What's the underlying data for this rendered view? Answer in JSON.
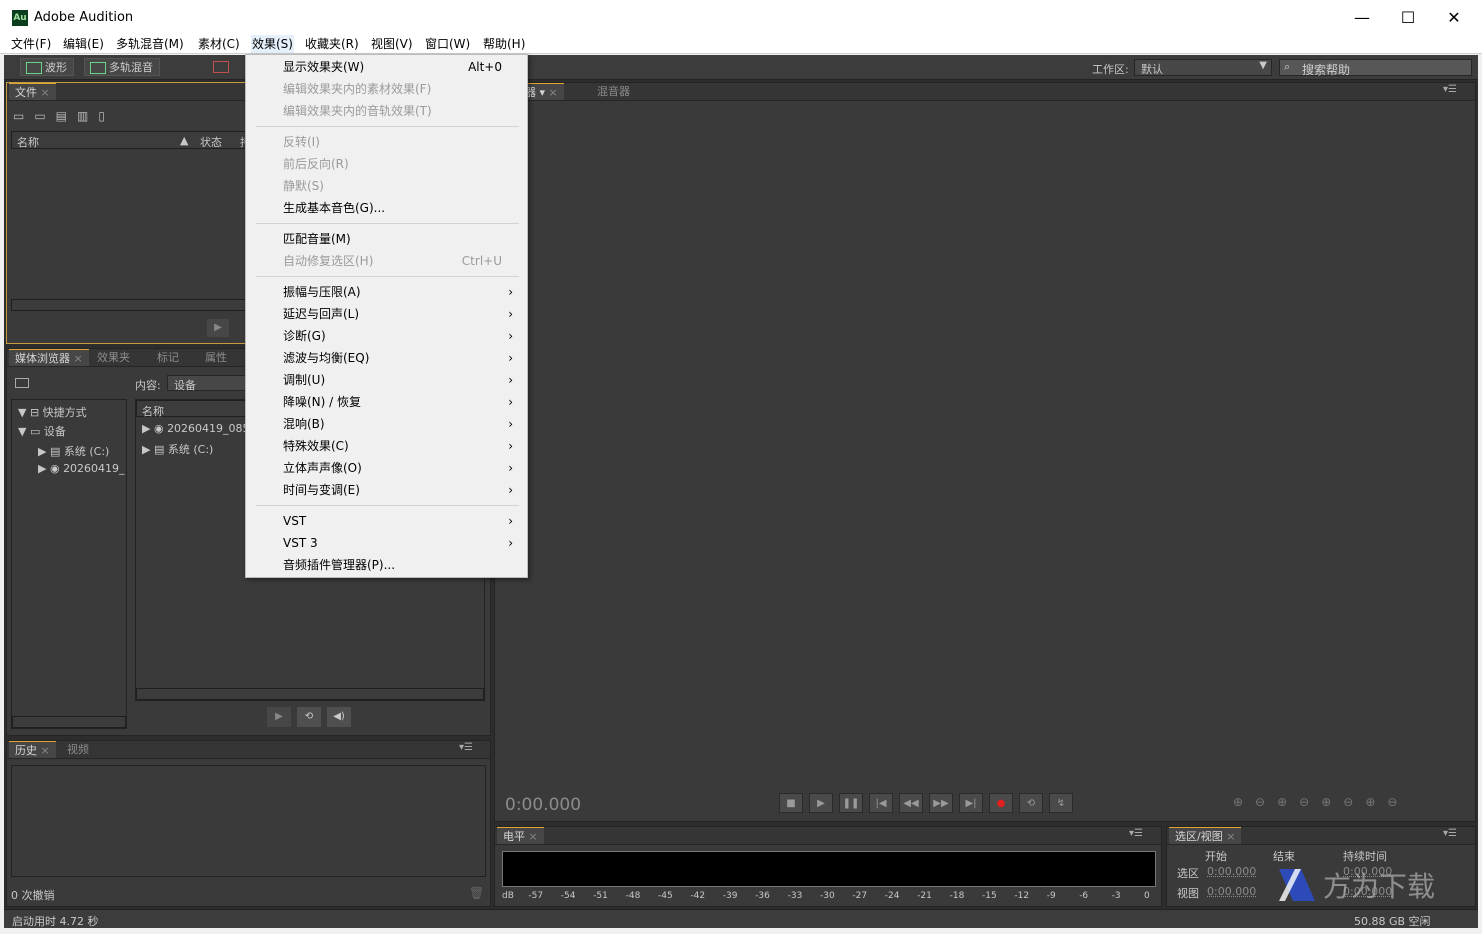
{
  "title_bar": {
    "app_icon_text": "Au",
    "title": "Adobe Audition",
    "minimize": "—",
    "maximize": "☐",
    "close": "✕"
  },
  "menubar": {
    "items": [
      "文件(F)",
      "编辑(E)",
      "多轨混音(M)",
      "素材(C)",
      "效果(S)",
      "收藏夹(R)",
      "视图(V)",
      "窗口(W)",
      "帮助(H)"
    ]
  },
  "toolbar": {
    "waveform": "波形",
    "multitrack": "多轨混音",
    "workspace_label": "工作区:",
    "workspace_value": "默认",
    "search_placeholder": "搜索帮助"
  },
  "files_panel": {
    "tab": "文件",
    "col_name": "名称",
    "col_status": "状态",
    "col_extra": "持"
  },
  "media_panel": {
    "tabs": [
      "媒体浏览器",
      "效果夹",
      "标记",
      "属性"
    ],
    "content_label": "内容:",
    "content_value": "设备",
    "tree": [
      "快捷方式",
      "设备",
      "系统 (C:)",
      "20260419_"
    ],
    "col_name": "名称",
    "list": [
      "20260419_085",
      "系统 (C:)"
    ]
  },
  "history_panel": {
    "tabs": [
      "历史",
      "视频"
    ],
    "undo_count": "0 次撤销"
  },
  "editor_panel": {
    "tabs": [
      "编辑器",
      "混音器"
    ],
    "timecode": "0:00.000"
  },
  "levels_panel": {
    "tab": "电平",
    "scale": [
      "dB",
      "-57",
      "-54",
      "-51",
      "-48",
      "-45",
      "-42",
      "-39",
      "-36",
      "-33",
      "-30",
      "-27",
      "-24",
      "-21",
      "-18",
      "-15",
      "-12",
      "-9",
      "-6",
      "-3",
      "0"
    ]
  },
  "selview_panel": {
    "tab": "选区/视图",
    "col_start": "开始",
    "col_end": "结束",
    "col_duration": "持续时间",
    "row_selection": "选区",
    "row_view": "视图",
    "sel_start": "0:00.000",
    "view_start": "0:00.000",
    "sel_duration": "0:00.000",
    "view_duration": "0:00.000"
  },
  "status": {
    "startup": "启动用时 4.72 秒",
    "free_space": "50.88 GB 空闲"
  },
  "watermark": {
    "text": "方为下载"
  },
  "effects_menu": {
    "items": [
      {
        "label": "显示效果夹(W)",
        "shortcut": "Alt+0",
        "disabled": false
      },
      {
        "label": "编辑效果夹内的素材效果(F)",
        "disabled": true
      },
      {
        "label": "编辑效果夹内的音轨效果(T)",
        "disabled": true
      },
      {
        "label": "反转(I)",
        "disabled": true
      },
      {
        "label": "前后反向(R)",
        "disabled": true
      },
      {
        "label": "静默(S)",
        "disabled": true
      },
      {
        "label": "生成基本音色(G)...",
        "disabled": false
      },
      {
        "label": "匹配音量(M)",
        "disabled": false
      },
      {
        "label": "自动修复选区(H)",
        "shortcut": "Ctrl+U",
        "disabled": true
      },
      {
        "label": "振幅与压限(A)",
        "submenu": true
      },
      {
        "label": "延迟与回声(L)",
        "submenu": true
      },
      {
        "label": "诊断(G)",
        "submenu": true
      },
      {
        "label": "滤波与均衡(EQ)",
        "submenu": true
      },
      {
        "label": "调制(U)",
        "submenu": true
      },
      {
        "label": "降噪(N) / 恢复",
        "submenu": true
      },
      {
        "label": "混响(B)",
        "submenu": true
      },
      {
        "label": "特殊效果(C)",
        "submenu": true
      },
      {
        "label": "立体声声像(O)",
        "submenu": true
      },
      {
        "label": "时间与变调(E)",
        "submenu": true
      },
      {
        "label": "VST",
        "submenu": true
      },
      {
        "label": "VST 3",
        "submenu": true
      },
      {
        "label": "音频插件管理器(P)...",
        "disabled": false
      }
    ],
    "arrow": "›"
  }
}
